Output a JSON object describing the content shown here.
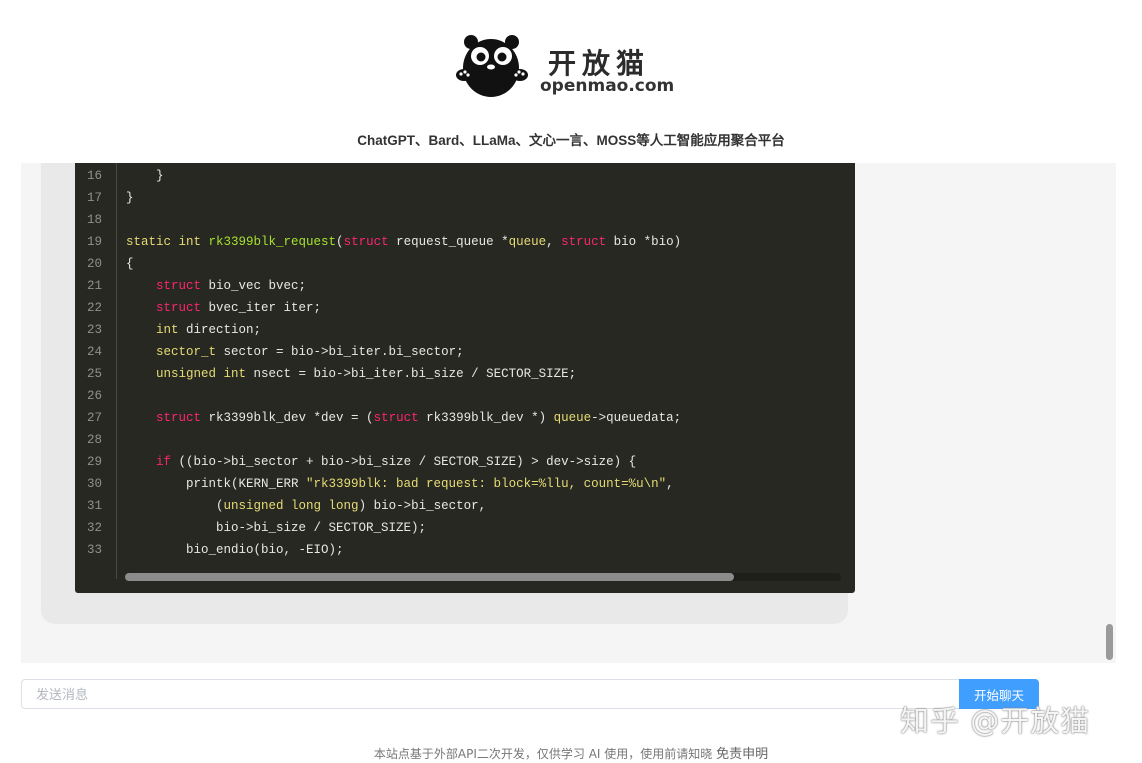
{
  "header": {
    "logo_cn": "开放猫",
    "logo_en": "openmao.com",
    "tagline": "ChatGPT、Bard、LLaMa、文心一言、MOSS等人工智能应用聚合平台"
  },
  "code_lines": [
    {
      "no": "16",
      "tokens": [
        {
          "t": "    }",
          "c": ""
        }
      ]
    },
    {
      "no": "17",
      "tokens": [
        {
          "t": "}",
          "c": ""
        }
      ]
    },
    {
      "no": "18",
      "tokens": []
    },
    {
      "no": "19",
      "tokens": [
        {
          "t": "static int ",
          "c": "ty"
        },
        {
          "t": "rk3399blk_request",
          "c": "fn"
        },
        {
          "t": "(",
          "c": ""
        },
        {
          "t": "struct",
          "c": "kw"
        },
        {
          "t": " request_queue *",
          "c": ""
        },
        {
          "t": "queue",
          "c": "ty"
        },
        {
          "t": ", ",
          "c": ""
        },
        {
          "t": "struct",
          "c": "kw"
        },
        {
          "t": " bio *bio)",
          "c": ""
        }
      ]
    },
    {
      "no": "20",
      "tokens": [
        {
          "t": "{",
          "c": ""
        }
      ]
    },
    {
      "no": "21",
      "tokens": [
        {
          "t": "    ",
          "c": ""
        },
        {
          "t": "struct",
          "c": "kw"
        },
        {
          "t": " bio_vec bvec;",
          "c": ""
        }
      ]
    },
    {
      "no": "22",
      "tokens": [
        {
          "t": "    ",
          "c": ""
        },
        {
          "t": "struct",
          "c": "kw"
        },
        {
          "t": " bvec_iter iter;",
          "c": ""
        }
      ]
    },
    {
      "no": "23",
      "tokens": [
        {
          "t": "    ",
          "c": ""
        },
        {
          "t": "int",
          "c": "ty"
        },
        {
          "t": " direction;",
          "c": ""
        }
      ]
    },
    {
      "no": "24",
      "tokens": [
        {
          "t": "    ",
          "c": ""
        },
        {
          "t": "sector_t",
          "c": "ty"
        },
        {
          "t": " sector = bio->bi_iter.bi_sector;",
          "c": ""
        }
      ]
    },
    {
      "no": "25",
      "tokens": [
        {
          "t": "    ",
          "c": ""
        },
        {
          "t": "unsigned int",
          "c": "ty"
        },
        {
          "t": " nsect = bio->bi_iter.bi_size / SECTOR_SIZE;",
          "c": ""
        }
      ]
    },
    {
      "no": "26",
      "tokens": []
    },
    {
      "no": "27",
      "tokens": [
        {
          "t": "    ",
          "c": ""
        },
        {
          "t": "struct",
          "c": "kw"
        },
        {
          "t": " rk3399blk_dev *dev = (",
          "c": ""
        },
        {
          "t": "struct",
          "c": "kw"
        },
        {
          "t": " rk3399blk_dev *) ",
          "c": ""
        },
        {
          "t": "queue",
          "c": "ty"
        },
        {
          "t": "->queuedata;",
          "c": ""
        }
      ]
    },
    {
      "no": "28",
      "tokens": []
    },
    {
      "no": "29",
      "tokens": [
        {
          "t": "    ",
          "c": ""
        },
        {
          "t": "if",
          "c": "kw"
        },
        {
          "t": " ((bio->bi_sector + bio->bi_size / SECTOR_SIZE) > dev->size) {",
          "c": ""
        }
      ]
    },
    {
      "no": "30",
      "tokens": [
        {
          "t": "        printk(KERN_ERR ",
          "c": ""
        },
        {
          "t": "\"rk3399blk: bad request: block=%llu, count=%u\\n\"",
          "c": "st"
        },
        {
          "t": ",",
          "c": ""
        }
      ]
    },
    {
      "no": "31",
      "tokens": [
        {
          "t": "            (",
          "c": ""
        },
        {
          "t": "unsigned long long",
          "c": "ty"
        },
        {
          "t": ") bio->bi_sector,",
          "c": ""
        }
      ]
    },
    {
      "no": "32",
      "tokens": [
        {
          "t": "            bio->bi_size / SECTOR_SIZE);",
          "c": ""
        }
      ]
    },
    {
      "no": "33",
      "tokens": [
        {
          "t": "        bio_endio(bio, -EIO);",
          "c": ""
        }
      ]
    }
  ],
  "scroll": {
    "code_horizontal_fraction": 0.85
  },
  "input": {
    "placeholder": "发送消息"
  },
  "send_label": "开始聊天",
  "watermark": "知乎 @开放猫",
  "footer": {
    "text": "本站点基于外部API二次开发，仅供学习 AI 使用，使用前请知晓 ",
    "link": "免责申明"
  }
}
